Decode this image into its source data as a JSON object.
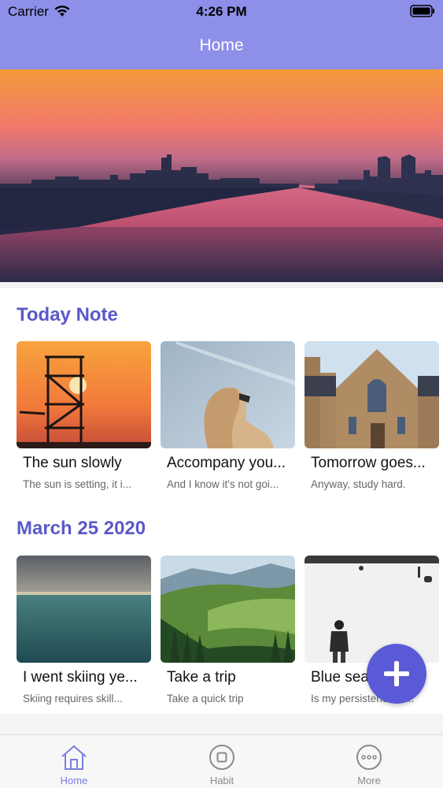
{
  "status_bar": {
    "carrier": "Carrier",
    "time": "4:26 PM"
  },
  "nav": {
    "title": "Home"
  },
  "sections": [
    {
      "title": "Today Note",
      "cards": [
        {
          "title": "The sun slowly",
          "subtitle": "The sun is setting, it i..."
        },
        {
          "title": "Accompany you...",
          "subtitle": "And I know it's not goi..."
        },
        {
          "title": "Tomorrow goes...",
          "subtitle": "Anyway, study hard."
        }
      ]
    },
    {
      "title": "March 25 2020",
      "cards": [
        {
          "title": "I went skiing ye...",
          "subtitle": "Skiing requires skill..."
        },
        {
          "title": "Take a trip",
          "subtitle": "Take a quick trip"
        },
        {
          "title": "Blue sea...",
          "subtitle": "Is my persistence ta..."
        }
      ]
    }
  ],
  "tabbar": {
    "items": [
      {
        "label": "Home",
        "icon": "home-icon",
        "active": true
      },
      {
        "label": "Habit",
        "icon": "square-circle-icon",
        "active": false
      },
      {
        "label": "More",
        "icon": "more-dots-icon",
        "active": false
      }
    ]
  },
  "colors": {
    "header": "#8d8fe8",
    "accent": "#5a59c9",
    "fab": "#5b5ad6",
    "tab_active": "#7b7ee0",
    "tab_inactive": "#8a8a8a"
  }
}
